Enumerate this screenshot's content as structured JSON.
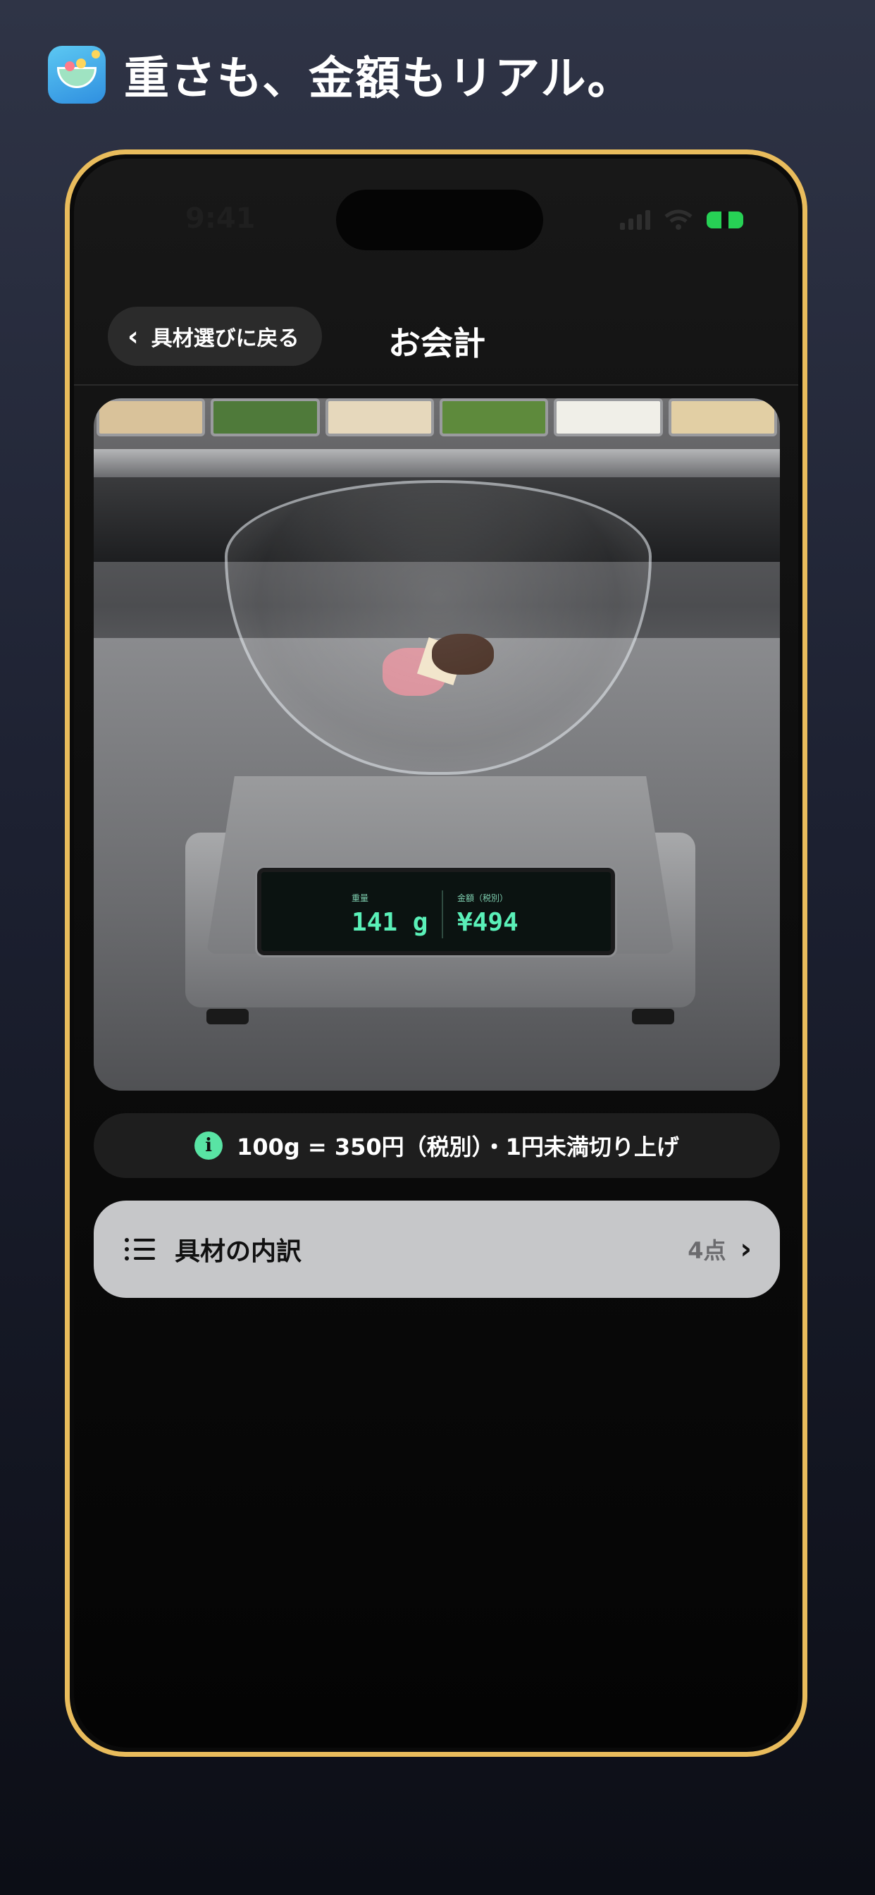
{
  "headline": "重さも、金額もリアル。",
  "status": {
    "time": "9:41"
  },
  "nav": {
    "back_label": "具材選びに戻る",
    "title": "お会計"
  },
  "scale_display": {
    "weight_label": "重量",
    "weight_value": "141 g",
    "price_label": "金額（税別）",
    "price_value": "¥494"
  },
  "info": {
    "text": "100g = 350円（税別）・1円未満切り上げ",
    "icon": "info-icon"
  },
  "breakdown": {
    "label": "具材の内訳",
    "count": "4点",
    "icon": "list-icon"
  },
  "colors": {
    "accent_green": "#59e4a4",
    "phone_frame": "#e9bc5c",
    "battery": "#27d155"
  }
}
